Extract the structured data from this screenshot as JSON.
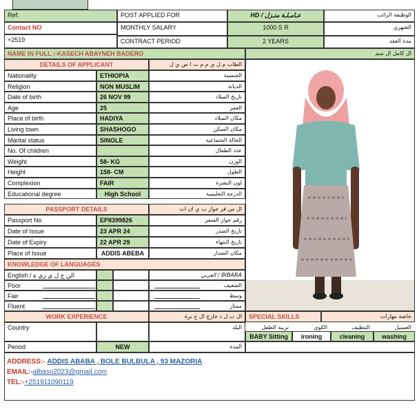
{
  "top": {
    "ref_label": "Ref:",
    "contact_label": "Contact NO",
    "phone_prefix": "+2519",
    "post_applied_label": "POST APPLIED FOR",
    "post_applied_value": "HD / عـامـلـة منـزل",
    "post_applied_ar": "الوظيفة الرائب",
    "salary_label": "MONTHLY SALARY",
    "salary_value": "1000 S R",
    "salary_ar": "الشهري",
    "contract_label": "CONTRACT PERIOD",
    "contract_value": "2 YEARS",
    "contract_ar": "مدة العقد"
  },
  "name": {
    "label": "NAME IN FULL :-KASECH ABAYNEH BADERO",
    "ar": "ال كامل ال سم"
  },
  "applicant": {
    "header": "DETAILS OF APPLICANT",
    "header_ar": "الطاب م ل ي م م ت ا ص ي ل",
    "rows": [
      {
        "label": "Nationality",
        "value": "ETHIOPIA",
        "ar": "الجنسية"
      },
      {
        "label": "Religion",
        "value": "NON MUSLIM",
        "ar": "الديانة"
      },
      {
        "label": "Date of birth",
        "value": "26 NOV 99",
        "ar": "تاريخ الميلاد"
      },
      {
        "label": "Age",
        "value": "25",
        "ar": "العمر"
      },
      {
        "label": "Place of birth",
        "value": "HADIYA",
        "ar": "مكان الميلاد"
      },
      {
        "label": "Living town",
        "value": "SHASHOGO",
        "ar": "مكان السكن"
      },
      {
        "label": "Marital status",
        "value": "SINGLE",
        "ar": "الحالة الجتماعية"
      },
      {
        "label": "No. Of children",
        "value": "",
        "ar": "عدد الطفال"
      },
      {
        "label": "Weight",
        "value": "58- KG",
        "ar": "الوزن"
      },
      {
        "label": "Height",
        "value": "158- CM",
        "ar": "الطول"
      },
      {
        "label": "Complexion",
        "value": "FAIR",
        "ar": "لون البشرة"
      },
      {
        "label": "Educational degree",
        "value": "High School",
        "ar": "الدرجة التعليمية"
      }
    ]
  },
  "passport": {
    "header": "PASSPORT DETAILS",
    "header_ar": "ال س فر جواز ب ي ان ات",
    "rows": [
      {
        "label": "Passport No",
        "value": "EP8399826",
        "ar": "رقم جواز السفر"
      },
      {
        "label": "Date of Issue",
        "value": "23 APR 24",
        "ar": "تاريخ الصدر"
      },
      {
        "label": "Date of Expiry",
        "value": "22 APR 29",
        "ar": "تاريخ النتهاء"
      },
      {
        "label": "Place of Issue",
        "value": "ADDIS ABEBA",
        "ar": "مكان الصدار"
      }
    ]
  },
  "languages": {
    "header": "KNOWLEDGE OF LANGUAGES",
    "rows": [
      {
        "label": "English / الن ج ل ي زي ة",
        "ar": "BIBARA / العربي"
      },
      {
        "label": "Poor",
        "ar": "الضعيف"
      },
      {
        "label": "Fair",
        "ar": "وسط"
      },
      {
        "label": "Fluent",
        "ar": "ممتاز"
      }
    ]
  },
  "experience": {
    "header": "WORK EXPERIENCE",
    "header_ar": "ال ب ل د خارج ال خ برة",
    "country_label": "Country",
    "country_ar": "البلد",
    "period_label": "Period",
    "period_value": "NEW",
    "period_ar": "المدة"
  },
  "skills": {
    "header": "SPECIAL SKILLS",
    "header_ar": "خاصة مهارات",
    "ar_items": [
      "تربية الطفل",
      "الكوي",
      "التنظيف",
      "الغسيل"
    ],
    "items": [
      "BABY Sitting",
      "ironing",
      "cleaning",
      "washing"
    ]
  },
  "contact": {
    "address_label": "ADDRESS:-",
    "address_value": "ADDIS ABABA , BOLE BULBULA , 93 MAZORIA",
    "email_label": "EMAIL:-",
    "email_value": "albaso2023@gmail.com",
    "tel_label": "TEL:-",
    "tel_value": "+251911090119"
  },
  "colors": {
    "header_green": "#c5e0b3",
    "header_peach": "#fbe4d5",
    "header_text": "#c0504d",
    "link_blue": "#2e5fa3"
  }
}
